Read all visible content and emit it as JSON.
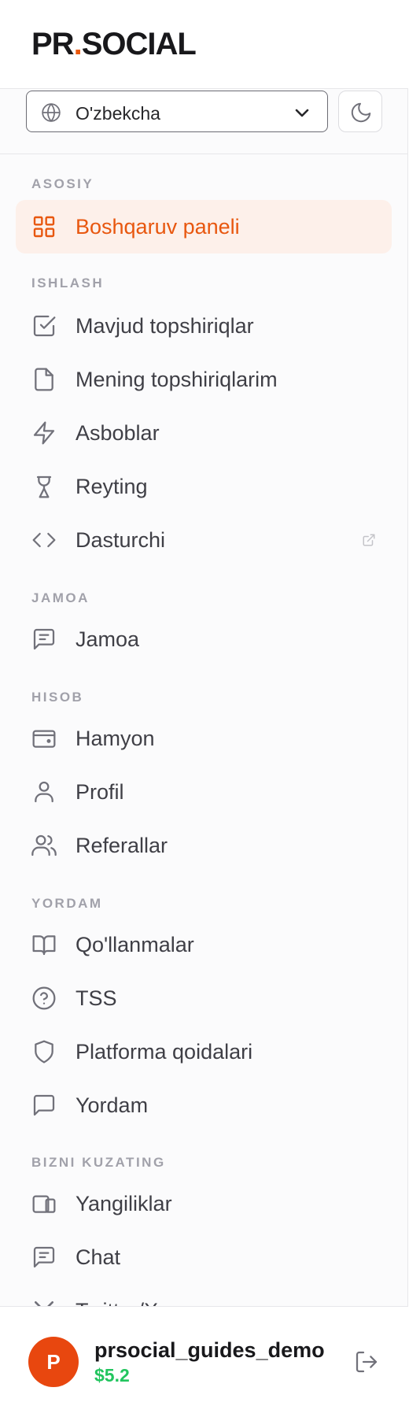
{
  "app": {
    "logo_left": "PR",
    "logo_dot": ".",
    "logo_right": "SOCIAL"
  },
  "language": {
    "current": "O'zbekcha"
  },
  "theme_toggle": {
    "icon": "moon-icon"
  },
  "sections": [
    {
      "title": "ASOSIY",
      "items": [
        {
          "label": "Boshqaruv paneli",
          "icon": "grid-icon",
          "active": true
        }
      ]
    },
    {
      "title": "ISHLASH",
      "items": [
        {
          "label": "Mavjud topshiriqlar",
          "icon": "checkbox-icon"
        },
        {
          "label": "Mening topshiriqlarim",
          "icon": "file-icon"
        },
        {
          "label": "Asboblar",
          "icon": "lightning-icon"
        },
        {
          "label": "Reyting",
          "icon": "trophy-icon"
        },
        {
          "label": "Dasturchi",
          "icon": "code-icon",
          "external": true
        }
      ]
    },
    {
      "title": "JAMOA",
      "items": [
        {
          "label": "Jamoa",
          "icon": "message-square-text-icon"
        }
      ]
    },
    {
      "title": "HISOB",
      "items": [
        {
          "label": "Hamyon",
          "icon": "wallet-icon"
        },
        {
          "label": "Profil",
          "icon": "user-icon"
        },
        {
          "label": "Referallar",
          "icon": "users-icon"
        }
      ]
    },
    {
      "title": "YORDAM",
      "items": [
        {
          "label": "Qo'llanmalar",
          "icon": "book-icon"
        },
        {
          "label": "TSS",
          "icon": "help-circle-icon"
        },
        {
          "label": "Platforma qoidalari",
          "icon": "shield-icon"
        },
        {
          "label": "Yordam",
          "icon": "message-square-icon"
        }
      ]
    },
    {
      "title": "BIZNI KUZATING",
      "items": [
        {
          "label": "Yangiliklar",
          "icon": "devices-icon"
        },
        {
          "label": "Chat",
          "icon": "chat-icon"
        },
        {
          "label": "Twitter/X",
          "icon": "x-icon"
        }
      ]
    }
  ],
  "user": {
    "avatar_letter": "P",
    "name": "prsocial_guides_demo",
    "balance": "$5.2"
  },
  "colors": {
    "accent": "#e8570f",
    "active_bg": "#fdf0ea",
    "balance": "#22c55e",
    "muted": "#a1a1aa"
  }
}
